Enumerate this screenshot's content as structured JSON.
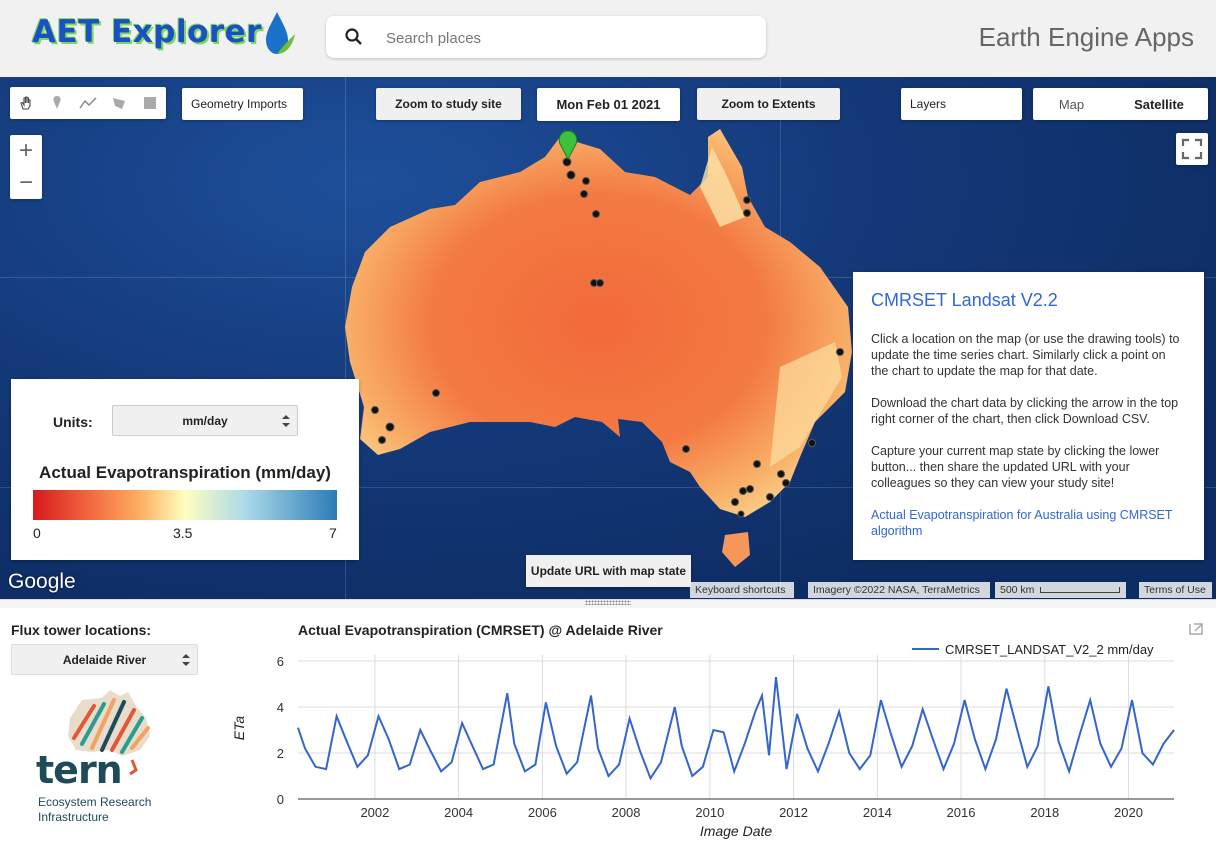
{
  "header": {
    "app_title": "AET Explorer",
    "search_placeholder": "Search places",
    "ee_title": "Earth Engine Apps"
  },
  "toolbar": {
    "geometry_imports": "Geometry Imports",
    "zoom_study_site": "Zoom to study site",
    "date": "Mon Feb 01 2021",
    "zoom_extents": "Zoom to Extents",
    "layers": "Layers",
    "map_type_map": "Map",
    "map_type_satellite": "Satellite"
  },
  "zoom": {
    "plus": "+",
    "minus": "−"
  },
  "info_panel": {
    "title": "CMRSET Landsat V2.2",
    "para1": "Click a location on the map (or use the drawing tools) to update the time series chart. Similarly click a point on the chart to update the map for that date.",
    "para2": "Download the chart data by clicking the arrow in the top right corner of the chart, then click Download CSV.",
    "para3": "Capture your current map state by clicking the lower button... then share the updated URL with your colleagues so they can view your study site!",
    "link": "Actual Evapotranspiration for Australia using CMRSET algorithm"
  },
  "legend_panel": {
    "units_label": "Units:",
    "units_value": "mm/day",
    "title": "Actual Evapotranspiration (mm/day)",
    "min": "0",
    "mid": "3.5",
    "max": "7",
    "colors": [
      "#d7191c",
      "#f46d43",
      "#fdae61",
      "#ffffbf",
      "#abd9e9",
      "#2c7bb6"
    ]
  },
  "update_button": "Update URL with map state",
  "map_footer": {
    "google": "Google",
    "keyboard": "Keyboard shortcuts",
    "imagery": "Imagery ©2022 NASA, TerraMetrics",
    "scale": "500 km",
    "terms": "Terms of Use"
  },
  "flux": {
    "label": "Flux tower locations:",
    "selected": "Adelaide River"
  },
  "tern": {
    "name": "tern",
    "line1": "Ecosystem Research",
    "line2": "Infrastructure"
  },
  "chart_data": {
    "type": "line",
    "title": "Actual Evapotranspiration (CMRSET) @ Adelaide River",
    "xlabel": "Image Date",
    "ylabel": "ETa",
    "ylim": [
      0,
      6
    ],
    "yticks": [
      0,
      2,
      4,
      6
    ],
    "xticks": [
      "2002",
      "2004",
      "2006",
      "2008",
      "2010",
      "2012",
      "2014",
      "2016",
      "2018",
      "2020"
    ],
    "xlim": [
      "2000-03-01",
      "2021-02-01"
    ],
    "legend_position": "top-right",
    "series": [
      {
        "name": "CMRSET_LANDSAT_V2_2 mm/day",
        "color": "#3366cc",
        "x": [
          "2000-03-01",
          "2000-05-01",
          "2000-08-01",
          "2000-11-01",
          "2001-02-01",
          "2001-05-01",
          "2001-08-01",
          "2001-11-01",
          "2002-02-01",
          "2002-05-01",
          "2002-08-01",
          "2002-11-01",
          "2003-02-01",
          "2003-05-01",
          "2003-08-01",
          "2003-11-01",
          "2004-02-01",
          "2004-05-01",
          "2004-08-01",
          "2004-11-01",
          "2005-03-01",
          "2005-05-01",
          "2005-08-01",
          "2005-11-01",
          "2006-02-01",
          "2006-05-01",
          "2006-08-01",
          "2006-11-01",
          "2007-03-01",
          "2007-05-01",
          "2007-08-01",
          "2007-11-01",
          "2008-02-01",
          "2008-05-01",
          "2008-08-01",
          "2008-11-01",
          "2009-03-01",
          "2009-05-01",
          "2009-08-01",
          "2009-11-01",
          "2010-02-01",
          "2010-05-01",
          "2010-08-01",
          "2010-11-01",
          "2011-02-01",
          "2011-04-01",
          "2011-06-01",
          "2011-08-01",
          "2011-11-01",
          "2012-02-01",
          "2012-05-01",
          "2012-08-01",
          "2012-11-01",
          "2013-02-01",
          "2013-05-01",
          "2013-08-01",
          "2013-11-01",
          "2014-02-01",
          "2014-05-01",
          "2014-08-01",
          "2014-11-01",
          "2015-02-01",
          "2015-05-01",
          "2015-08-01",
          "2015-11-01",
          "2016-02-01",
          "2016-05-01",
          "2016-08-01",
          "2016-11-01",
          "2017-02-01",
          "2017-05-01",
          "2017-08-01",
          "2017-11-01",
          "2018-02-01",
          "2018-05-01",
          "2018-08-01",
          "2018-11-01",
          "2019-02-01",
          "2019-05-01",
          "2019-08-01",
          "2019-11-01",
          "2020-02-01",
          "2020-05-01",
          "2020-08-01",
          "2020-11-01",
          "2021-02-01"
        ],
        "values": [
          3.1,
          2.2,
          1.4,
          1.3,
          3.6,
          2.5,
          1.4,
          1.9,
          3.6,
          2.6,
          1.3,
          1.5,
          3.0,
          2.1,
          1.2,
          1.6,
          3.3,
          2.3,
          1.3,
          1.5,
          4.6,
          2.4,
          1.2,
          1.5,
          4.2,
          2.3,
          1.1,
          1.6,
          4.5,
          2.2,
          1.0,
          1.5,
          3.5,
          2.1,
          0.9,
          1.6,
          4.0,
          2.3,
          1.0,
          1.4,
          3.0,
          2.9,
          1.2,
          2.4,
          3.8,
          4.5,
          1.9,
          5.3,
          1.3,
          3.7,
          2.2,
          1.2,
          2.4,
          3.8,
          2.0,
          1.3,
          1.9,
          4.3,
          2.8,
          1.4,
          2.3,
          3.9,
          2.6,
          1.3,
          2.4,
          4.3,
          2.6,
          1.3,
          2.6,
          4.8,
          3.1,
          1.4,
          2.3,
          4.9,
          2.5,
          1.2,
          2.8,
          4.3,
          2.4,
          1.4,
          2.2,
          4.3,
          2.0,
          1.5,
          2.4,
          3.0
        ]
      }
    ]
  }
}
